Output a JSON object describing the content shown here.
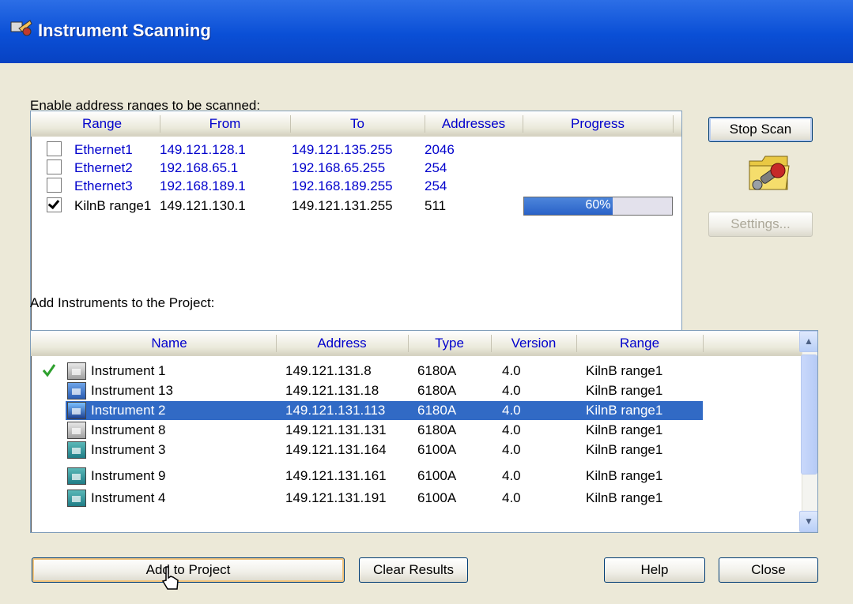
{
  "window": {
    "title": "Instrument Scanning"
  },
  "ranges": {
    "label": "Enable address ranges to be scanned:",
    "columns": [
      "Range",
      "From",
      "To",
      "Addresses",
      "Progress"
    ],
    "rows": [
      {
        "checked": false,
        "range": "Ethernet1",
        "from": "149.121.128.1",
        "to": "149.121.135.255",
        "addresses": "2046",
        "progress": ""
      },
      {
        "checked": false,
        "range": "Ethernet2",
        "from": "192.168.65.1",
        "to": "192.168.65.255",
        "addresses": "254",
        "progress": ""
      },
      {
        "checked": false,
        "range": "Ethernet3",
        "from": "192.168.189.1",
        "to": "192.168.189.255",
        "addresses": "254",
        "progress": ""
      },
      {
        "checked": true,
        "range": "KilnB range1",
        "from": "149.121.130.1",
        "to": "149.121.131.255",
        "addresses": "511",
        "progress": "60%",
        "progress_fraction": 0.6
      }
    ]
  },
  "buttons": {
    "stop_scan": "Stop Scan",
    "settings": "Settings...",
    "add_to_project": "Add to Project",
    "clear_results": "Clear Results",
    "help": "Help",
    "close": "Close"
  },
  "instruments": {
    "label": "Add Instruments to the Project:",
    "columns": [
      "Name",
      "Address",
      "Type",
      "Version",
      "Range"
    ],
    "rows": [
      {
        "added": true,
        "icon": "instrument-gray-icon",
        "name": "Instrument 1",
        "address": "149.121.131.8",
        "type": "6180A",
        "version": "4.0",
        "range": "KilnB range1"
      },
      {
        "added": false,
        "icon": "instrument-blue-icon",
        "name": "Instrument 13",
        "address": "149.121.131.18",
        "type": "6180A",
        "version": "4.0",
        "range": "KilnB range1"
      },
      {
        "added": false,
        "icon": "instrument-color-icon",
        "name": "Instrument 2",
        "address": "149.121.131.113",
        "type": "6180A",
        "version": "4.0",
        "range": "KilnB range1",
        "selected": true
      },
      {
        "added": false,
        "icon": "instrument-gray-icon",
        "name": "Instrument 8",
        "address": "149.121.131.131",
        "type": "6180A",
        "version": "4.0",
        "range": "KilnB range1"
      },
      {
        "added": false,
        "icon": "instrument-teal-icon",
        "name": "Instrument 3",
        "address": "149.121.131.164",
        "type": "6100A",
        "version": "4.0",
        "range": "KilnB range1"
      },
      {
        "added": false,
        "icon": "instrument-teal-icon",
        "name": "Instrument 9",
        "address": "149.121.131.161",
        "type": "6100A",
        "version": "4.0",
        "range": "KilnB range1"
      },
      {
        "added": false,
        "icon": "instrument-teal-icon",
        "name": "Instrument 4",
        "address": "149.121.131.191",
        "type": "6100A",
        "version": "4.0",
        "range": "KilnB range1"
      }
    ]
  },
  "colors": {
    "selection": "#316ac5",
    "header_text": "#0000cc",
    "progress_fill": "#316ac5",
    "checkmark": "#2ea02e"
  }
}
